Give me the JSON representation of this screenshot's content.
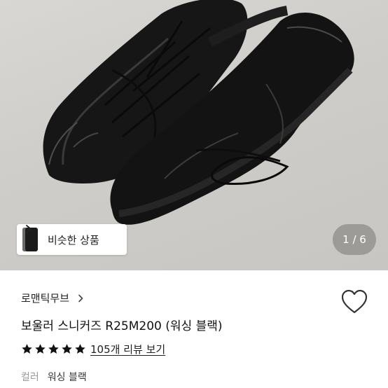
{
  "gallery": {
    "counter": "1 / 6",
    "similar_button_label": "비슷한 상품"
  },
  "product": {
    "brand": "로맨틱무브",
    "title": "보울러 스니커즈 R25M200 (워싱 블랙)",
    "rating": 5,
    "review_link": "105개 리뷰 보기",
    "option_key": "컬러",
    "option_value": "워싱 블랙"
  },
  "icons": {
    "brand_chevron": "chevron-right-icon",
    "wishlist": "heart-outline-icon",
    "star": "star-filled-icon"
  },
  "colors": {
    "photo_bg": "#d0ceca",
    "shoe": "#141414",
    "star": "#111111",
    "counter_bg": "#7a7874"
  }
}
